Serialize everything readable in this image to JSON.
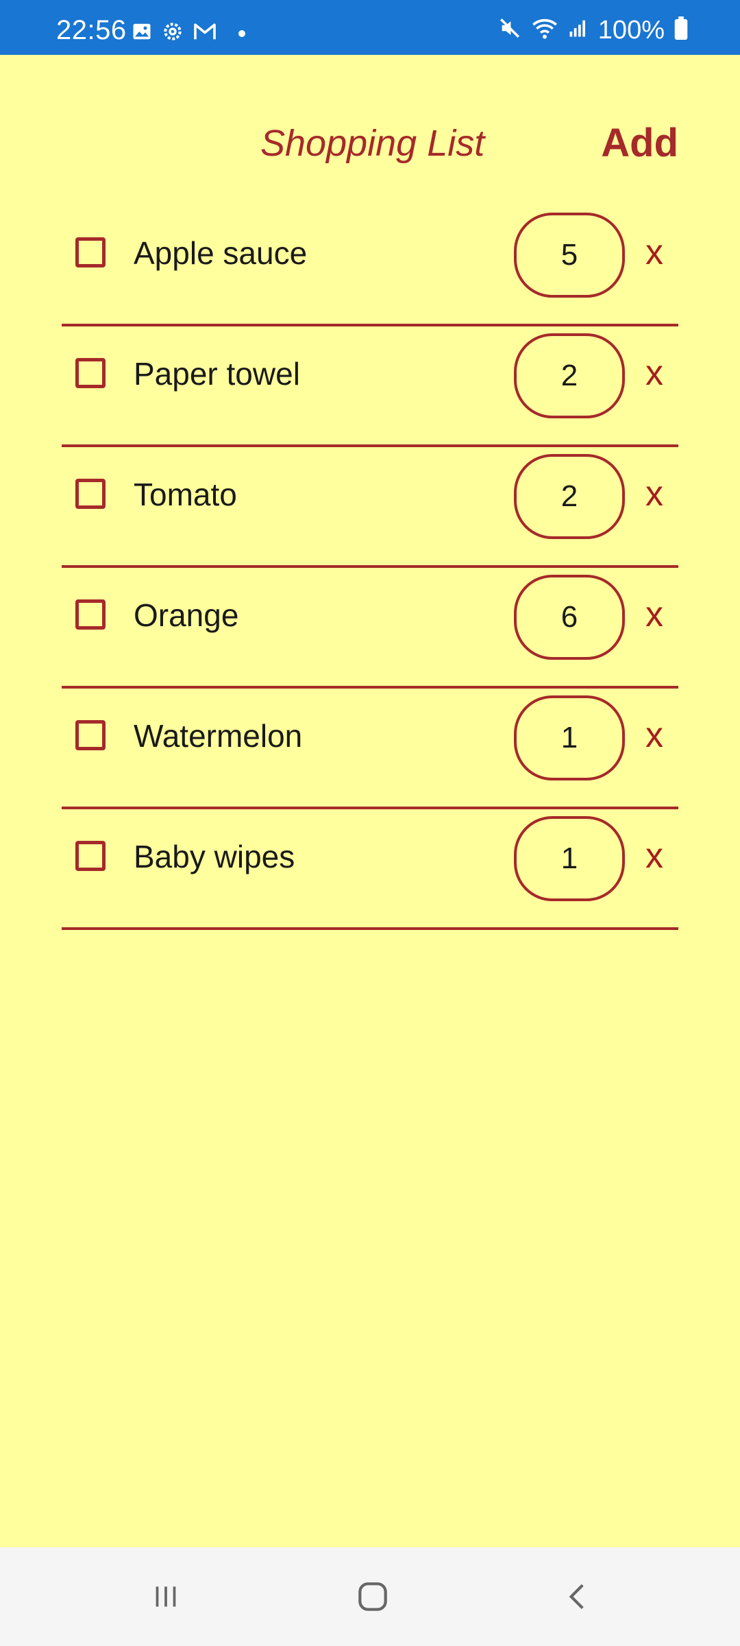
{
  "status_bar": {
    "time": "22:56",
    "battery": "100%",
    "left_icons": [
      "gallery-icon",
      "settings-icon",
      "gmail-icon",
      "notification-dot"
    ],
    "right_icons": [
      "mute-icon",
      "wifi-icon",
      "signal-icon",
      "battery-icon"
    ]
  },
  "header": {
    "title": "Shopping List",
    "add_label": "Add"
  },
  "items": [
    {
      "name": "Apple sauce",
      "qty": "5",
      "delete": "x",
      "checked": false
    },
    {
      "name": "Paper towel",
      "qty": "2",
      "delete": "x",
      "checked": false
    },
    {
      "name": "Tomato",
      "qty": "2",
      "delete": "x",
      "checked": false
    },
    {
      "name": "Orange",
      "qty": "6",
      "delete": "x",
      "checked": false
    },
    {
      "name": "Watermelon",
      "qty": "1",
      "delete": "x",
      "checked": false
    },
    {
      "name": "Baby wipes",
      "qty": "1",
      "delete": "x",
      "checked": false
    }
  ],
  "nav": {
    "buttons": [
      "recent-apps-icon",
      "home-icon",
      "back-icon"
    ]
  },
  "colors": {
    "status_bar": "#1976d2",
    "background": "#ffff9d",
    "accent": "#a52a2a",
    "nav_bar": "#f5f5f5"
  }
}
